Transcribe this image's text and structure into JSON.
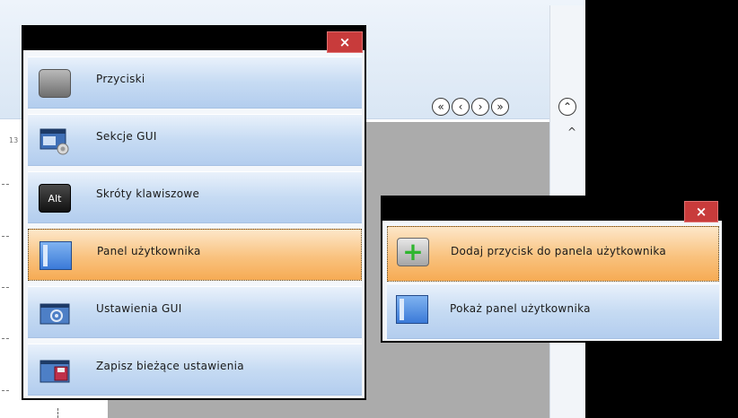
{
  "background": {
    "ruler_number": "13",
    "nav_buttons": [
      {
        "icon": "double-left-icon",
        "glyph": "«"
      },
      {
        "icon": "left-icon",
        "glyph": "‹"
      },
      {
        "icon": "right-icon",
        "glyph": "›"
      },
      {
        "icon": "double-right-icon",
        "glyph": "»"
      }
    ],
    "collapse_glyph": "⌃",
    "scroll_up_glyph": "^"
  },
  "menu": {
    "close_label": "×",
    "items": [
      {
        "label": "Przyciski",
        "icon": "button-icon"
      },
      {
        "label": "Sekcje GUI",
        "icon": "gui-sections-icon"
      },
      {
        "label": "Skróty klawiszowe",
        "icon": "alt-key-icon",
        "icon_text": "Alt"
      },
      {
        "label": "Panel użytkownika",
        "icon": "user-panel-icon",
        "selected": true
      },
      {
        "label": "Ustawienia GUI",
        "icon": "gui-settings-icon"
      },
      {
        "label": "Zapisz bieżące ustawienia",
        "icon": "save-settings-icon"
      }
    ]
  },
  "submenu": {
    "close_label": "×",
    "items": [
      {
        "label": "Dodaj przycisk do panela użytkownika",
        "icon": "add-icon",
        "selected": true
      },
      {
        "label": "Pokaż panel użytkownika",
        "icon": "user-panel-icon"
      }
    ]
  },
  "colors": {
    "selected": "#f6ab54",
    "item": "#c6dbf3",
    "close": "#c83b3b"
  }
}
